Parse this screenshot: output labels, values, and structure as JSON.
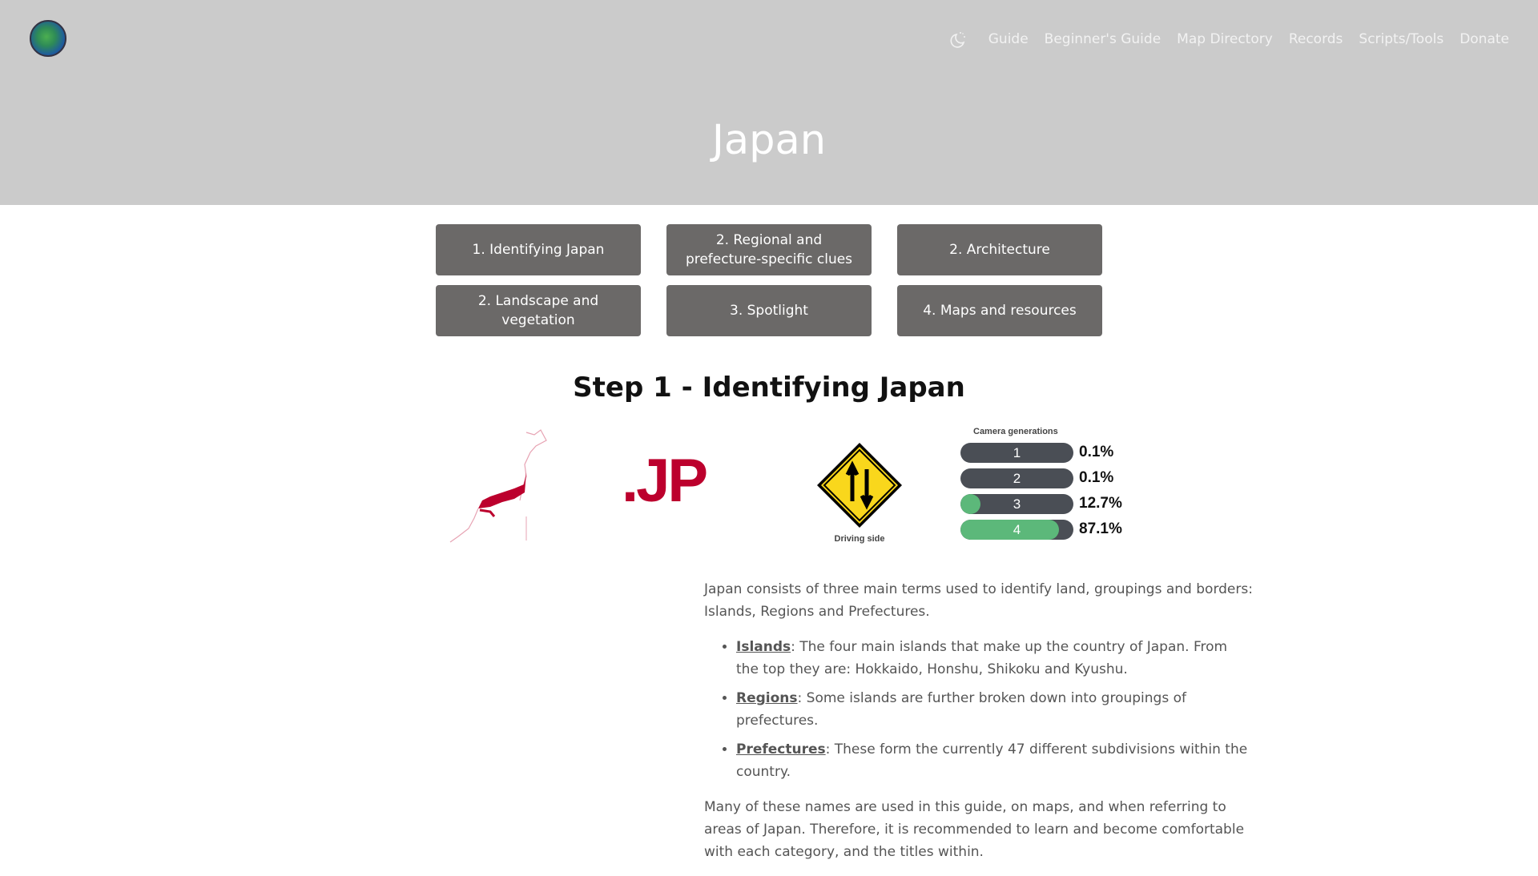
{
  "nav": {
    "items": [
      "Guide",
      "Beginner's Guide",
      "Map Directory",
      "Records",
      "Scripts/Tools",
      "Donate"
    ]
  },
  "header": {
    "title": "Japan"
  },
  "sections": [
    "1. Identifying Japan",
    "2. Regional and prefecture-specific clues",
    "2. Architecture",
    "2. Landscape and vegetation",
    "3. Spotlight",
    "4. Maps and resources"
  ],
  "step_title": "Step 1 - Identifying Japan",
  "images": {
    "tld": ".JP",
    "driving_label": "Driving side",
    "camera_title": "Camera generations",
    "cameras": [
      {
        "gen": "1",
        "pct": "0.1%",
        "value": 0.1
      },
      {
        "gen": "2",
        "pct": "0.1%",
        "value": 0.1
      },
      {
        "gen": "3",
        "pct": "12.7%",
        "value": 12.7
      },
      {
        "gen": "4",
        "pct": "87.1%",
        "value": 87.1
      }
    ]
  },
  "content": {
    "intro": "Japan consists of three main terms used to identify land, groupings and borders: Islands, Regions and Prefectures.",
    "bullets": [
      {
        "term": "Islands",
        "text": ": The four main islands that make up the country of Japan. From the top they are: Hokkaido, Honshu, Shikoku and Kyushu."
      },
      {
        "term": "Regions",
        "text": ": Some islands are further broken down into groupings of prefectures."
      },
      {
        "term": "Prefectures",
        "text": ": These form the currently 47 different subdivisions within the country."
      }
    ],
    "outro": "Many of these names are used in this guide, on maps, and when referring to areas of Japan. Therefore, it is recommended to learn and become comfortable with each category, and the titles within."
  },
  "colors": {
    "header": "#cbcbcb",
    "button": "#6b6968",
    "japan_red": "#bc002d",
    "camera_green": "#5cb87a"
  }
}
